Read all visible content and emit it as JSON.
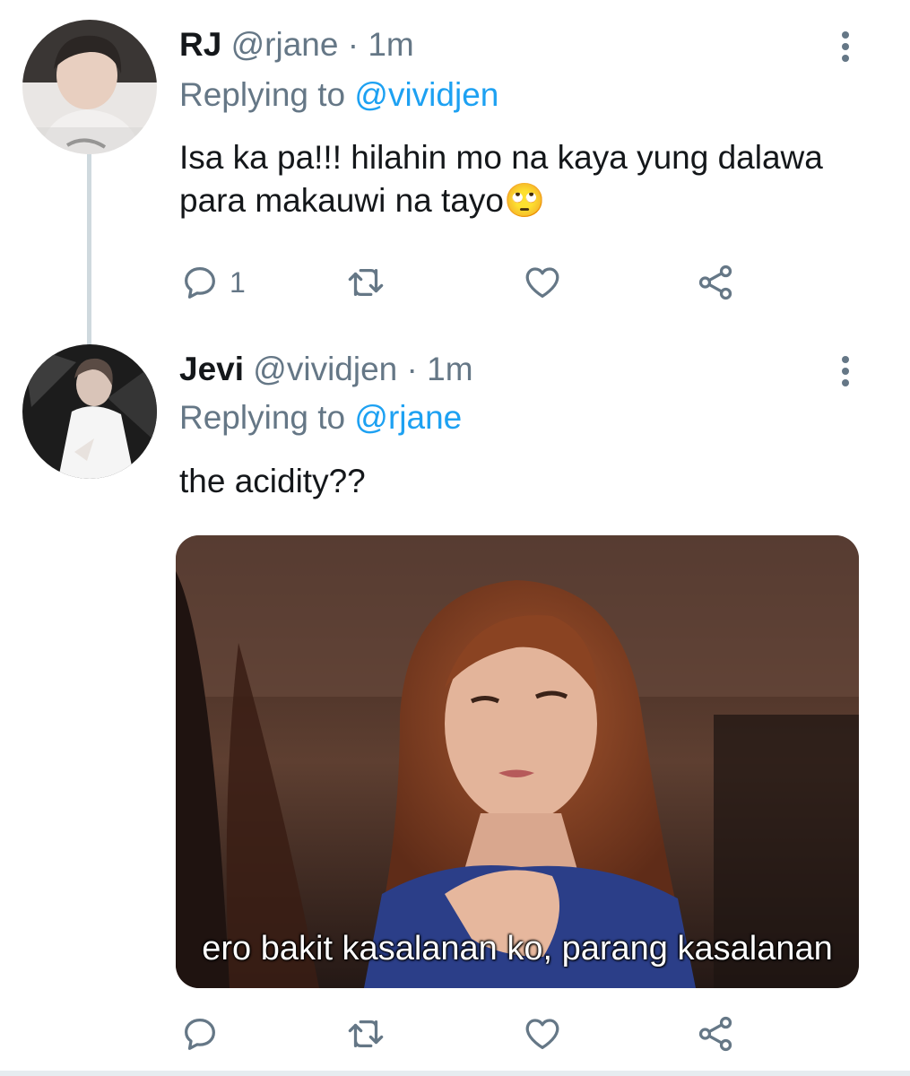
{
  "colors": {
    "accent": "#1da1f2",
    "muted": "#657786",
    "text": "#14171a",
    "thread_line": "#cfd9de"
  },
  "tweets": [
    {
      "name": "RJ",
      "handle": "@rjane",
      "separator": "·",
      "time": "1m",
      "replying_label": "Replying to",
      "replying_to": "@vividjen",
      "text": "Isa ka pa!!! hilahin mo na kaya yung dalawa para makauwi na tayo",
      "emoji": "🙄",
      "reply_count": "1",
      "icons": [
        "reply-icon",
        "retweet-icon",
        "like-icon",
        "share-icon",
        "more-icon"
      ]
    },
    {
      "name": "Jevi",
      "handle": "@vividjen",
      "separator": "·",
      "time": "1m",
      "replying_label": "Replying to",
      "replying_to": "@rjane",
      "text": "the acidity??",
      "media_caption": "ero bakit kasalanan ko, parang kasalanan",
      "reply_count": "",
      "icons": [
        "reply-icon",
        "retweet-icon",
        "like-icon",
        "share-icon",
        "more-icon"
      ]
    }
  ]
}
